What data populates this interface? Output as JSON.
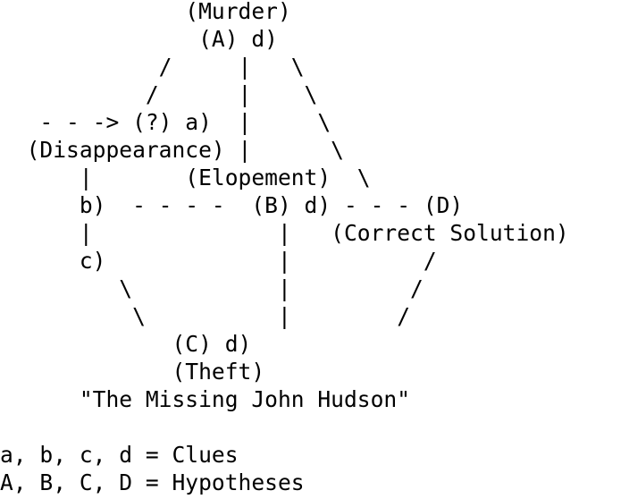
{
  "diagram": {
    "lines": [
      "              (Murder)",
      "               (A) d)",
      "            /     |   \\",
      "           /      |    \\",
      "   - - -> (?) a)  |     \\",
      "  (Disappearance) |      \\",
      "      |       (Elopement)  \\",
      "      b)  - - - -  (B) d) - - - (D)",
      "      |              |   (Correct Solution)",
      "      c)             |          /",
      "         \\           |         /",
      "          \\          |        /",
      "             (C) d)",
      "             (Theft)",
      "      \"The Missing John Hudson\"",
      "",
      "a, b, c, d = Clues",
      "A, B, C, D = Hypotheses"
    ]
  }
}
